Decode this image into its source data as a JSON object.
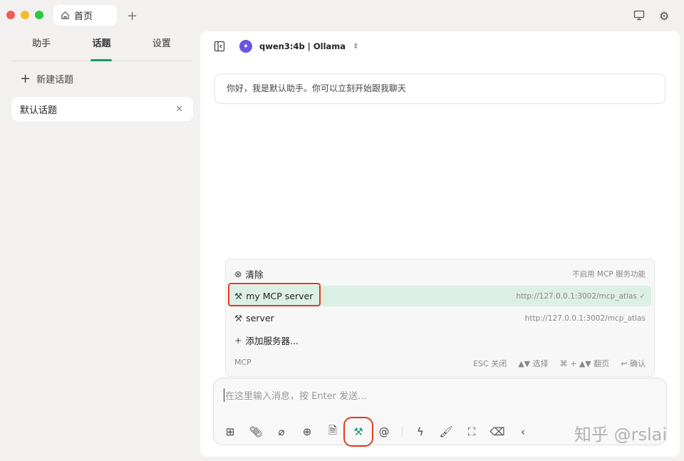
{
  "window": {
    "tab_label": "首页",
    "colors": {
      "close": "#ee5d55",
      "min": "#f6bc2f",
      "max": "#2dc840",
      "accent": "#1b9a6c",
      "highlight": "#e33b1e"
    }
  },
  "sidebar": {
    "tabs": [
      "助手",
      "话题",
      "设置"
    ],
    "active_tab": "话题",
    "new_topic": "新建话题",
    "topics": [
      {
        "label": "默认话题"
      }
    ]
  },
  "header": {
    "model": "qwen3:4b | Ollama"
  },
  "chat": {
    "greeting": "你好，我是默认助手。你可以立刻开始跟我聊天"
  },
  "mcp_popup": {
    "items": [
      {
        "label": "清除",
        "detail": "不启用 MCP 服务功能",
        "icon": "circle-x-icon"
      },
      {
        "label": "my MCP server",
        "detail": "http://127.0.0.1:3002/mcp_atlas",
        "check": "✓",
        "icon": "hammer-icon",
        "selected": true
      },
      {
        "label": "server",
        "detail": "http://127.0.0.1:3002/mcp_atlas",
        "icon": "hammer-icon"
      },
      {
        "label": "添加服务器...",
        "icon": "plus-icon"
      }
    ],
    "footer_label": "MCP",
    "hints": [
      "ESC 关闭",
      "▲▼ 选择",
      "⌘ + ▲▼ 翻页",
      "↩ 确认"
    ]
  },
  "input": {
    "placeholder": "在这里输入消息，按 Enter 发送..."
  },
  "watermark": "知乎 @rslai"
}
